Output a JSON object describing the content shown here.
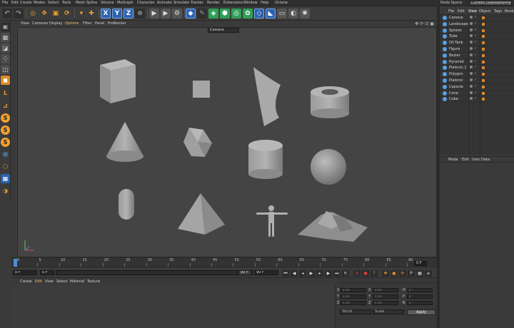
{
  "menubar": {
    "items": [
      "File",
      "Edit",
      "Create",
      "Modes",
      "Select",
      "Tools",
      "Mesh",
      "Spline",
      "Volume",
      "MoGraph",
      "Character",
      "Animate",
      "Simulate",
      "Tracker",
      "Render",
      "Extensions",
      "Window",
      "Help",
      "Octane"
    ],
    "node_space_label": "Node Space:",
    "node_space_value": "Current (Standard/Physical)"
  },
  "toolbar": {
    "axis_x": "X",
    "axis_y": "Y",
    "axis_z": "Z"
  },
  "viewport": {
    "menu": [
      "View",
      "Cameras",
      "Display",
      "Options",
      "Filter",
      "Panel",
      "ProRender"
    ],
    "camera_label": "Camera"
  },
  "timeline": {
    "ticks": [
      "0",
      "5",
      "10",
      "15",
      "20",
      "25",
      "30",
      "35",
      "40",
      "45",
      "50",
      "55",
      "60",
      "65",
      "70",
      "75",
      "80",
      "85",
      "90"
    ],
    "end_frame": "0 F"
  },
  "transport": {
    "current_frame": "0 F",
    "start_frame": "0 F",
    "end_frame_a": "90 F",
    "end_frame_b": "90 F"
  },
  "material_manager": {
    "menu": [
      "Create",
      "Edit",
      "View",
      "Select",
      "Material",
      "Texture"
    ]
  },
  "coordinates": {
    "pos_labels": [
      "X",
      "Y",
      "Z"
    ],
    "rot_labels": [
      "X",
      "Y",
      "Z"
    ],
    "size_labels": [
      "H",
      "P",
      "B"
    ],
    "pos_values": [
      "0 cm",
      "0 cm",
      "0 cm"
    ],
    "rot_values": [
      "0 cm",
      "0 cm",
      "0 cm"
    ],
    "size_values": [
      "0 °",
      "0 °",
      "0 °"
    ],
    "mode_a": "World",
    "mode_b": "Scale",
    "apply_label": "Apply"
  },
  "object_manager": {
    "menu": [
      "File",
      "Edit",
      "View",
      "Object",
      "Tags",
      "Bookm"
    ],
    "objects": [
      {
        "name": "Camera",
        "icon_color": "#5aa0e0"
      },
      {
        "name": "Landscape",
        "icon_color": "#5aa0e0"
      },
      {
        "name": "Sphere",
        "icon_color": "#5aa0e0"
      },
      {
        "name": "Tube",
        "icon_color": "#5aa0e0"
      },
      {
        "name": "Oil Tank",
        "icon_color": "#5aa0e0"
      },
      {
        "name": "Figure",
        "icon_color": "#5aa0e0"
      },
      {
        "name": "Bezier",
        "icon_color": "#5aa0e0"
      },
      {
        "name": "Pyramid",
        "icon_color": "#5aa0e0"
      },
      {
        "name": "Platonic.1",
        "icon_color": "#5aa0e0"
      },
      {
        "name": "Polygon",
        "icon_color": "#5aa0e0"
      },
      {
        "name": "Platonic",
        "icon_color": "#5aa0e0"
      },
      {
        "name": "Capsule",
        "icon_color": "#5aa0e0"
      },
      {
        "name": "Cone",
        "icon_color": "#5aa0e0"
      },
      {
        "name": "Cube",
        "icon_color": "#5aa0e0"
      }
    ]
  },
  "attributes": {
    "menu": [
      "Mode",
      "Edit",
      "User Data"
    ]
  },
  "colors": {
    "accent_orange": "#f0a030",
    "accent_blue": "#2c62b0",
    "viewport_bg": "#444444",
    "tag_orange": "#e08a2a"
  }
}
